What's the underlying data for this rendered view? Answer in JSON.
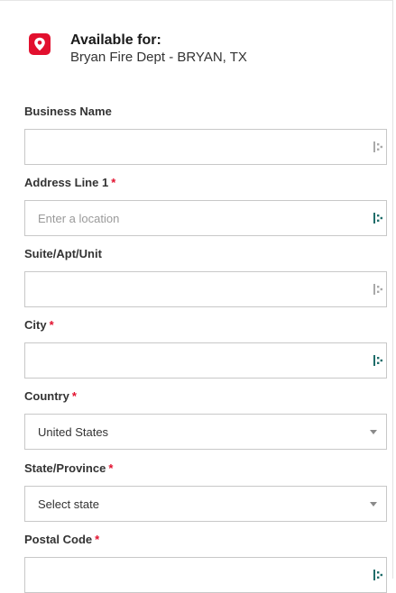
{
  "availability": {
    "title": "Available for:",
    "location": "Bryan Fire Dept - BRYAN, TX",
    "pin_color": "#e2102e"
  },
  "fields": {
    "business_name": {
      "label": "Business Name",
      "required": false,
      "value": "",
      "placeholder": ""
    },
    "address_line1": {
      "label": "Address Line 1",
      "required_marker": "*",
      "value": "",
      "placeholder": "Enter a location"
    },
    "suite": {
      "label": "Suite/Apt/Unit",
      "value": "",
      "placeholder": ""
    },
    "city": {
      "label": "City",
      "required_marker": "*",
      "value": "",
      "placeholder": ""
    },
    "country": {
      "label": "Country",
      "required_marker": "*",
      "selected": "United States"
    },
    "state": {
      "label": "State/Province",
      "required_marker": "*",
      "selected": "Select state"
    },
    "postal_code": {
      "label": "Postal Code",
      "required_marker": "*",
      "value": "",
      "placeholder": ""
    }
  },
  "icons": {
    "location": "map-pin-icon",
    "autofill": "autofill-icon",
    "dropdown": "chevron-down-icon"
  },
  "colors": {
    "accent": "#e2102e",
    "autofill_active": "#1f6d6a",
    "autofill_inactive": "#a9a9a9"
  }
}
